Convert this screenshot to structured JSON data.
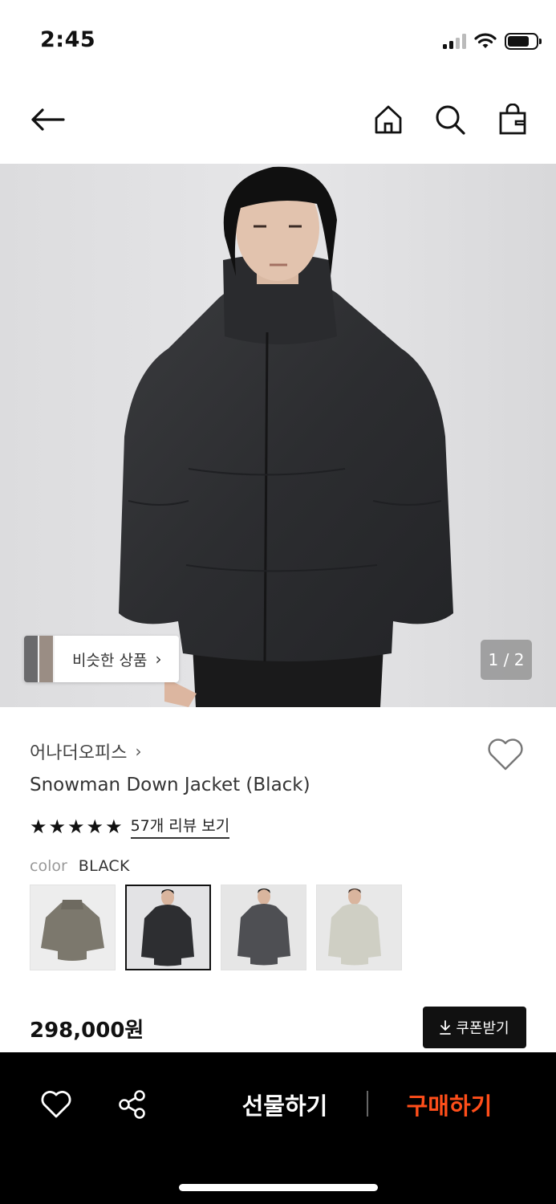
{
  "status_bar": {
    "time": "2:45"
  },
  "header": {
    "back_icon": "arrow-left-icon",
    "home_icon": "home-icon",
    "search_icon": "search-icon",
    "bag_icon": "shopping-bag-icon"
  },
  "hero": {
    "similar_label": "비슷한 상품",
    "page_indicator": "1 / 2"
  },
  "product": {
    "brand": "어나더오피스",
    "name": "Snowman Down Jacket (Black)",
    "rating_stars": 5,
    "review_link": "57개 리뷰 보기",
    "color_label": "color",
    "color_value": "BLACK",
    "swatches": [
      {
        "name": "khaki",
        "selected": false
      },
      {
        "name": "black",
        "selected": true
      },
      {
        "name": "charcoal",
        "selected": false
      },
      {
        "name": "ivory",
        "selected": false
      }
    ],
    "price": "298,000원",
    "coupon_label": "쿠폰받기"
  },
  "bottom_bar": {
    "wishlist_icon": "heart-icon",
    "share_icon": "share-icon",
    "gift_label": "선물하기",
    "buy_label": "구매하기"
  },
  "colors": {
    "accent": "#ff4e1a",
    "bottom_bar_bg": "#000000",
    "coupon_bg": "#111111"
  }
}
